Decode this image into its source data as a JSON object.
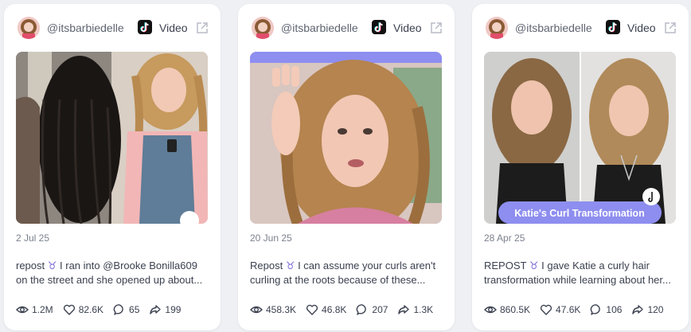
{
  "cards": [
    {
      "handle": "@itsbarbiedelle",
      "platform_label": "Video",
      "date": "2 Jul 25",
      "caption_line1_before": "repost ",
      "caption_symbol": "♉",
      "caption_line1_after": " I ran into @Brooke Bonilla609",
      "caption_line2": "on the street and she opened up about...",
      "views": "1.2M",
      "likes": "82.6K",
      "comments": "65",
      "shares": "199"
    },
    {
      "handle": "@itsbarbiedelle",
      "platform_label": "Video",
      "date": "20 Jun 25",
      "caption_line1_before": "Repost ",
      "caption_symbol": "♉",
      "caption_line1_after": " I can assume your curls aren't",
      "caption_line2": "curling at the roots because of these...",
      "views": "458.3K",
      "likes": "46.8K",
      "comments": "207",
      "shares": "1.3K"
    },
    {
      "handle": "@itsbarbiedelle",
      "platform_label": "Video",
      "date": "28 Apr 25",
      "caption_line1_before": "REPOST ",
      "caption_symbol": "♉",
      "caption_line1_after": " I gave Katie a curly hair",
      "caption_line2": "transformation while learning about her...",
      "views": "860.5K",
      "likes": "47.6K",
      "comments": "106",
      "shares": "120",
      "overlay_text": "Katie's Curl Transformation"
    }
  ],
  "icons": {
    "platform": "tiktok-logo",
    "open": "external-link-icon",
    "views": "eye-icon",
    "likes": "heart-icon",
    "comments": "comment-icon",
    "shares": "share-icon"
  },
  "colors": {
    "background": "#eef0f4",
    "card": "#ffffff",
    "text": "#3b4150",
    "muted": "#7a808c",
    "accent": "#7a6bd8",
    "overlay_pill": "#8e8ef0"
  }
}
